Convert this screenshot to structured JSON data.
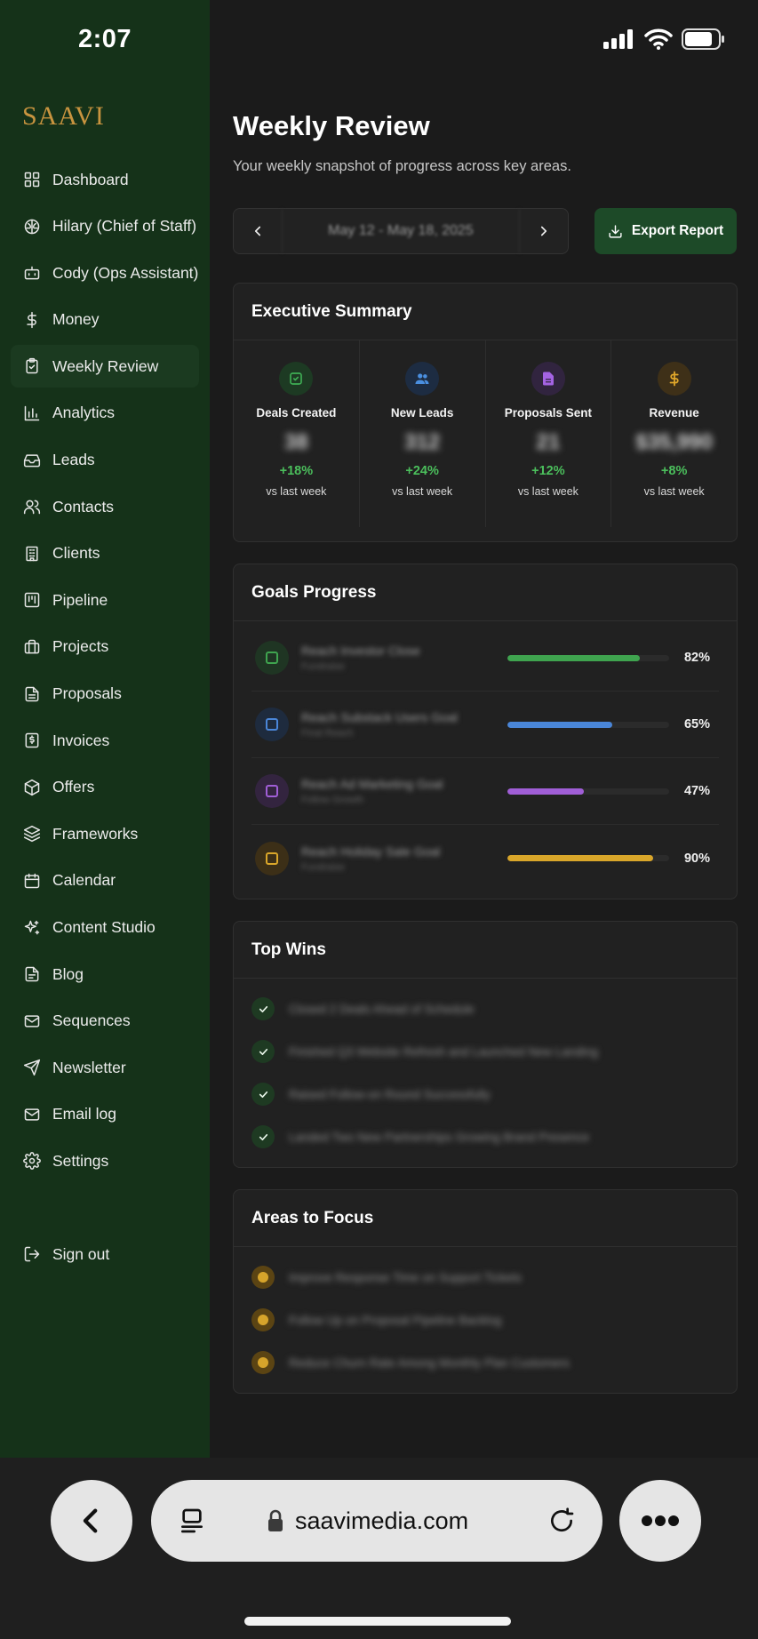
{
  "status": {
    "time": "2:07"
  },
  "brand": "SAAVI",
  "sidebar": {
    "items": [
      {
        "label": "Dashboard",
        "icon": "dashboard-icon"
      },
      {
        "label": "Hilary (Chief of Staff)",
        "icon": "brain-icon"
      },
      {
        "label": "Cody (Ops Assistant)",
        "icon": "bot-icon"
      },
      {
        "label": "Money",
        "icon": "dollar-icon"
      },
      {
        "label": "Weekly Review",
        "icon": "clipboard-check-icon",
        "active": true
      },
      {
        "label": "Analytics",
        "icon": "bar-chart-icon"
      },
      {
        "label": "Leads",
        "icon": "inbox-icon"
      },
      {
        "label": "Contacts",
        "icon": "users-icon"
      },
      {
        "label": "Clients",
        "icon": "building-icon"
      },
      {
        "label": "Pipeline",
        "icon": "kanban-icon"
      },
      {
        "label": "Projects",
        "icon": "briefcase-icon"
      },
      {
        "label": "Proposals",
        "icon": "file-text-icon"
      },
      {
        "label": "Invoices",
        "icon": "invoice-icon"
      },
      {
        "label": "Offers",
        "icon": "package-icon"
      },
      {
        "label": "Frameworks",
        "icon": "layers-icon"
      },
      {
        "label": "Calendar",
        "icon": "calendar-icon"
      },
      {
        "label": "Content Studio",
        "icon": "sparkles-icon"
      },
      {
        "label": "Blog",
        "icon": "file-icon"
      },
      {
        "label": "Sequences",
        "icon": "mail-icon"
      },
      {
        "label": "Newsletter",
        "icon": "send-icon"
      },
      {
        "label": "Email log",
        "icon": "mail-open-icon"
      },
      {
        "label": "Settings",
        "icon": "gear-icon"
      }
    ],
    "sign_out": "Sign out"
  },
  "header": {
    "title": "Weekly Review",
    "subtitle": "Your weekly snapshot of progress across key areas.",
    "date_range": "May 12 - May 18, 2025",
    "export_label": "Export Report"
  },
  "summary": {
    "title": "Executive Summary",
    "stats": [
      {
        "label": "Deals Created",
        "value": "38",
        "change": "+18%",
        "vs": "vs last week",
        "color": "#3fae55",
        "bg": "#1d3a23"
      },
      {
        "label": "New Leads",
        "value": "312",
        "change": "+24%",
        "vs": "vs last week",
        "color": "#4a8fe0",
        "bg": "#1d2c42"
      },
      {
        "label": "Proposals Sent",
        "value": "21",
        "change": "+12%",
        "vs": "vs last week",
        "color": "#a463e3",
        "bg": "#31243f"
      },
      {
        "label": "Revenue",
        "value": "$35,990",
        "change": "+8%",
        "vs": "vs last week",
        "color": "#e0a72a",
        "bg": "#3e3018"
      }
    ]
  },
  "goals": {
    "title": "Goals Progress",
    "items": [
      {
        "title": "Reach Investor Close",
        "sub": "Fundraise",
        "percent": 82,
        "pct_label": "82%",
        "color": "#3fa44f",
        "bg": "#1f3523"
      },
      {
        "title": "Reach Substack Users Goal",
        "sub": "Final Reach",
        "percent": 65,
        "pct_label": "65%",
        "color": "#4a86d8",
        "bg": "#1e2b3e"
      },
      {
        "title": "Reach Ad Marketing Goal",
        "sub": "Follow Growth",
        "percent": 47,
        "pct_label": "47%",
        "color": "#a05ed6",
        "bg": "#33243f"
      },
      {
        "title": "Reach Holiday Sale Goal",
        "sub": "Fundraise",
        "percent": 90,
        "pct_label": "90%",
        "color": "#d9a62a",
        "bg": "#3c2f17"
      }
    ]
  },
  "wins": {
    "title": "Top Wins",
    "items": [
      "Closed 2 Deals Ahead of Schedule",
      "Finished Q3 Website Refresh and Launched New Landing",
      "Raised Follow-on Round Successfully",
      "Landed Two New Partnerships Growing Brand Presence"
    ]
  },
  "focus": {
    "title": "Areas to Focus",
    "items": [
      "Improve Response Time on Support Tickets",
      "Follow Up on Proposal Pipeline Backlog",
      "Reduce Churn Rate Among Monthly Plan Customers"
    ]
  },
  "browser": {
    "url": "saavimedia.com"
  }
}
